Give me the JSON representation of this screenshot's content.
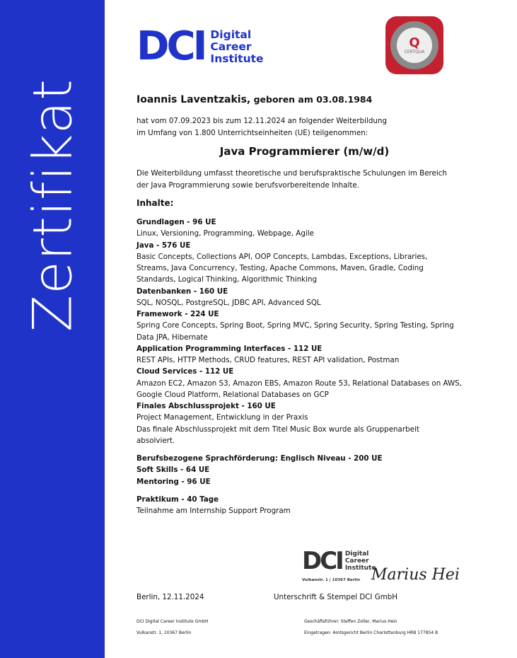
{
  "side_title": "Zertifikat",
  "logo": {
    "mark": "DCI",
    "line1": "Digital",
    "line2": "Career",
    "line3": "Institute"
  },
  "seal": {
    "text": "CERTQUA",
    "ring_top": "QUALITÄTSMANAGEMENT",
    "ring_bottom": "ZERTIFIZIERTER TRÄGER NACH AZAV"
  },
  "person": {
    "name": "Ioannis Laventzakis,",
    "born": " geboren am 03.08.1984"
  },
  "intro": [
    "hat vom 07.09.2023 bis zum 12.11.2024 an folgender Weiterbildung",
    "im Umfang von 1.800 Unterrichtseinheiten (UE) teilgenommen:"
  ],
  "course": "Java Programmierer (m/w/d)",
  "description": [
    "Die Weiterbildung umfasst theoretische und berufspraktische Schulungen im Bereich",
    "der Java Programmierung sowie berufsvorbereitende Inhalte."
  ],
  "contents_heading": "Inhalte:",
  "modules": [
    {
      "title": "Grundlagen - 96 UE",
      "text": "Linux, Versioning, Programming, Webpage, Agile"
    },
    {
      "title": "Java - 576 UE",
      "text": "Basic Concepts, Collections API, OOP Concepts, Lambdas, Exceptions, Libraries, Streams, Java Concurrency, Testing, Apache Commons, Maven, Gradle, Coding Standards, Logical Thinking, Algorithmic Thinking"
    },
    {
      "title": "Datenbanken - 160 UE",
      "text": "SQL, NOSQL, PostgreSQL, JDBC API, Advanced SQL"
    },
    {
      "title": "Framework - 224 UE",
      "text": "Spring Core Concepts, Spring Boot, Spring MVC, Spring Security, Spring Testing, Spring Data JPA, Hibernate"
    },
    {
      "title": "Application Programming Interfaces - 112 UE",
      "text": "REST APIs, HTTP Methods, CRUD features, REST API validation, Postman"
    },
    {
      "title": "Cloud Services - 112 UE",
      "text": "Amazon EC2, Amazon S3, Amazon EBS, Amazon Route 53, Relational Databases on AWS, Google Cloud Platform, Relational Databases on GCP"
    },
    {
      "title": "Finales Abschlussprojekt - 160 UE",
      "text": "Project Management, Entwicklung in der Praxis",
      "text2": "Das finale Abschlussprojekt mit dem Titel Music Box wurde als Gruppenarbeit absolviert."
    }
  ],
  "extras": [
    "Berufsbezogene Sprachförderung: Englisch Niveau  - 200 UE",
    "Soft Skills - 64 UE",
    "Mentoring - 96 UE"
  ],
  "internship": {
    "title": "Praktikum - 40 Tage",
    "text": "Teilnahme am Internship Support Program"
  },
  "stamp": {
    "mark": "DCI",
    "line1": "Digital",
    "line2": "Career",
    "line3": "Institute",
    "address": "Vulkanstr. 1  |  10367 Berlin"
  },
  "signature": "Marius Hei",
  "place_date": "Berlin, 12.11.2024",
  "signature_label": "Unterschrift & Stempel DCI GmbH",
  "footer": {
    "company": "DCI Digital Career Institute GmbH",
    "address": "Vulkanstr. 1, 10367 Berlin",
    "ceo": "Geschäftsführer: Steffen Zoller, Marius Hein",
    "register": "Eingetragen: Amtsgericht Berlin Charlottenburg HRB 177854 B"
  },
  "colors": {
    "brand_blue": "#1f33c8",
    "seal_red": "#c42130"
  }
}
